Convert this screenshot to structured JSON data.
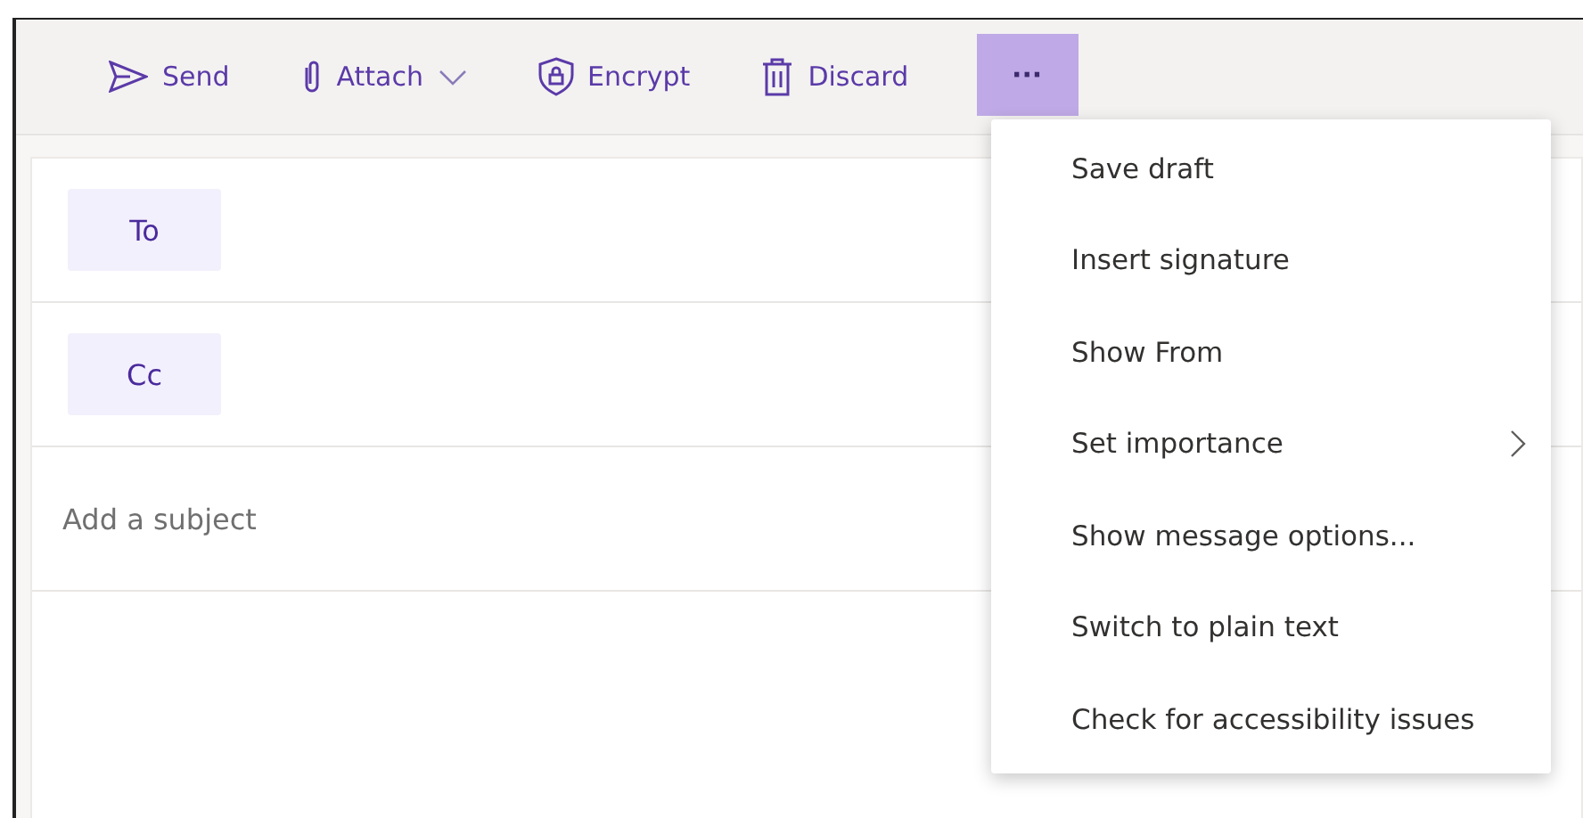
{
  "toolbar": {
    "buttons": [
      {
        "kind": "send",
        "label": "Send",
        "dropdown": false
      },
      {
        "kind": "attach",
        "label": "Attach",
        "dropdown": true
      },
      {
        "kind": "encrypt",
        "label": "Encrypt",
        "dropdown": false
      },
      {
        "kind": "discard",
        "label": "Discard",
        "dropdown": false
      }
    ],
    "more": {
      "label": "···",
      "selected": true
    }
  },
  "recipients": [
    {
      "label": "To"
    },
    {
      "label": "Cc"
    }
  ],
  "subject": {
    "placeholder": "Add a subject"
  },
  "menu": {
    "items": [
      {
        "label": "Save draft",
        "submenu": false
      },
      {
        "label": "Insert signature",
        "submenu": false
      },
      {
        "label": "Show From",
        "submenu": false
      },
      {
        "label": "Set importance",
        "submenu": true
      },
      {
        "label": "Show message options...",
        "submenu": false
      },
      {
        "label": "Switch to plain text",
        "submenu": false
      },
      {
        "label": "Check for accessibility issues",
        "submenu": false
      }
    ]
  }
}
